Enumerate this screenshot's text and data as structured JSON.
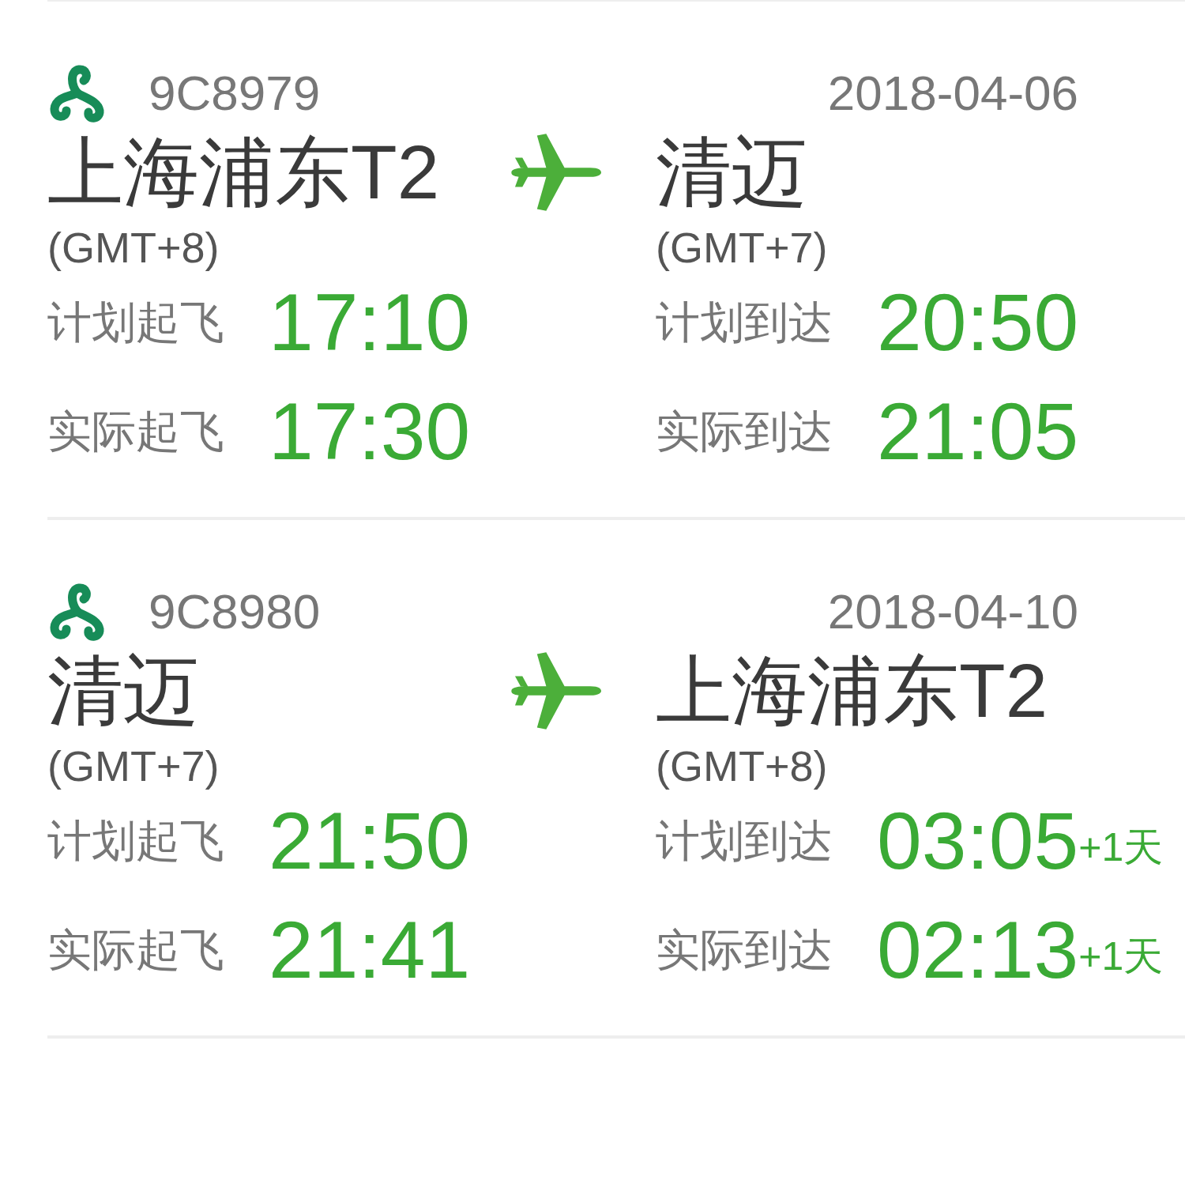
{
  "flights": [
    {
      "flight_no": "9C8979",
      "date": "2018-04-06",
      "departure": {
        "city": "上海浦东T2",
        "timezone": "(GMT+8)",
        "times": [
          {
            "label": "计划起飞",
            "time": "17:10"
          },
          {
            "label": "实际起飞",
            "time": "17:30"
          }
        ]
      },
      "arrival": {
        "city": "清迈",
        "timezone": "(GMT+7)",
        "times": [
          {
            "label": "计划到达",
            "time": "20:50"
          },
          {
            "label": "实际到达",
            "time": "21:05"
          }
        ]
      }
    },
    {
      "flight_no": "9C8980",
      "date": "2018-04-10",
      "departure": {
        "city": "清迈",
        "timezone": "(GMT+7)",
        "times": [
          {
            "label": "计划起飞",
            "time": "21:50"
          },
          {
            "label": "实际起飞",
            "time": "21:41"
          }
        ]
      },
      "arrival": {
        "city": "上海浦东T2",
        "timezone": "(GMT+8)",
        "times": [
          {
            "label": "计划到达",
            "time": "03:05",
            "next_day": "+1天"
          },
          {
            "label": "实际到达",
            "time": "02:13",
            "next_day": "+1天"
          }
        ]
      }
    }
  ]
}
